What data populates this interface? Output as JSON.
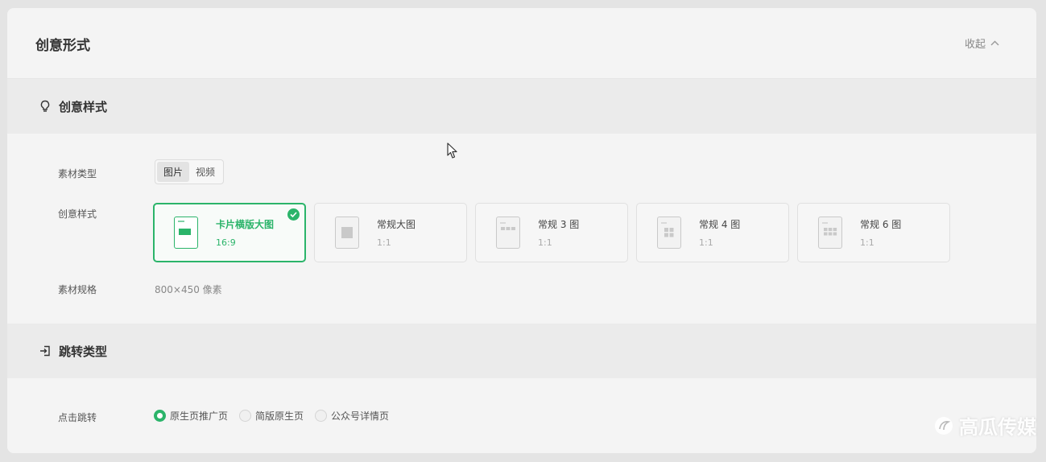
{
  "header": {
    "title": "创意形式",
    "collapse_label": "收起"
  },
  "style_section": {
    "title": "创意样式",
    "material_type_label": "素材类型",
    "material_types": [
      "图片",
      "视频"
    ],
    "selected_type": "图片",
    "creative_style_label": "创意样式",
    "cards": [
      {
        "name": "卡片横版大图",
        "ratio": "16:9",
        "selected": true
      },
      {
        "name": "常规大图",
        "ratio": "1:1",
        "selected": false
      },
      {
        "name": "常规 3 图",
        "ratio": "1:1",
        "selected": false
      },
      {
        "name": "常规 4 图",
        "ratio": "1:1",
        "selected": false
      },
      {
        "name": "常规 6 图",
        "ratio": "1:1",
        "selected": false
      }
    ],
    "spec_label": "素材规格",
    "spec_value": "800×450 像素"
  },
  "jump_section": {
    "title": "跳转类型",
    "click_label": "点击跳转",
    "options": [
      {
        "label": "原生页推广页",
        "selected": true
      },
      {
        "label": "简版原生页",
        "selected": false
      },
      {
        "label": "公众号详情页",
        "selected": false
      }
    ]
  },
  "watermark": {
    "text": "高瓜传媒"
  },
  "colors": {
    "accent": "#2bb46a",
    "panel": "#f4f4f4",
    "section_bar": "#ebebeb"
  }
}
